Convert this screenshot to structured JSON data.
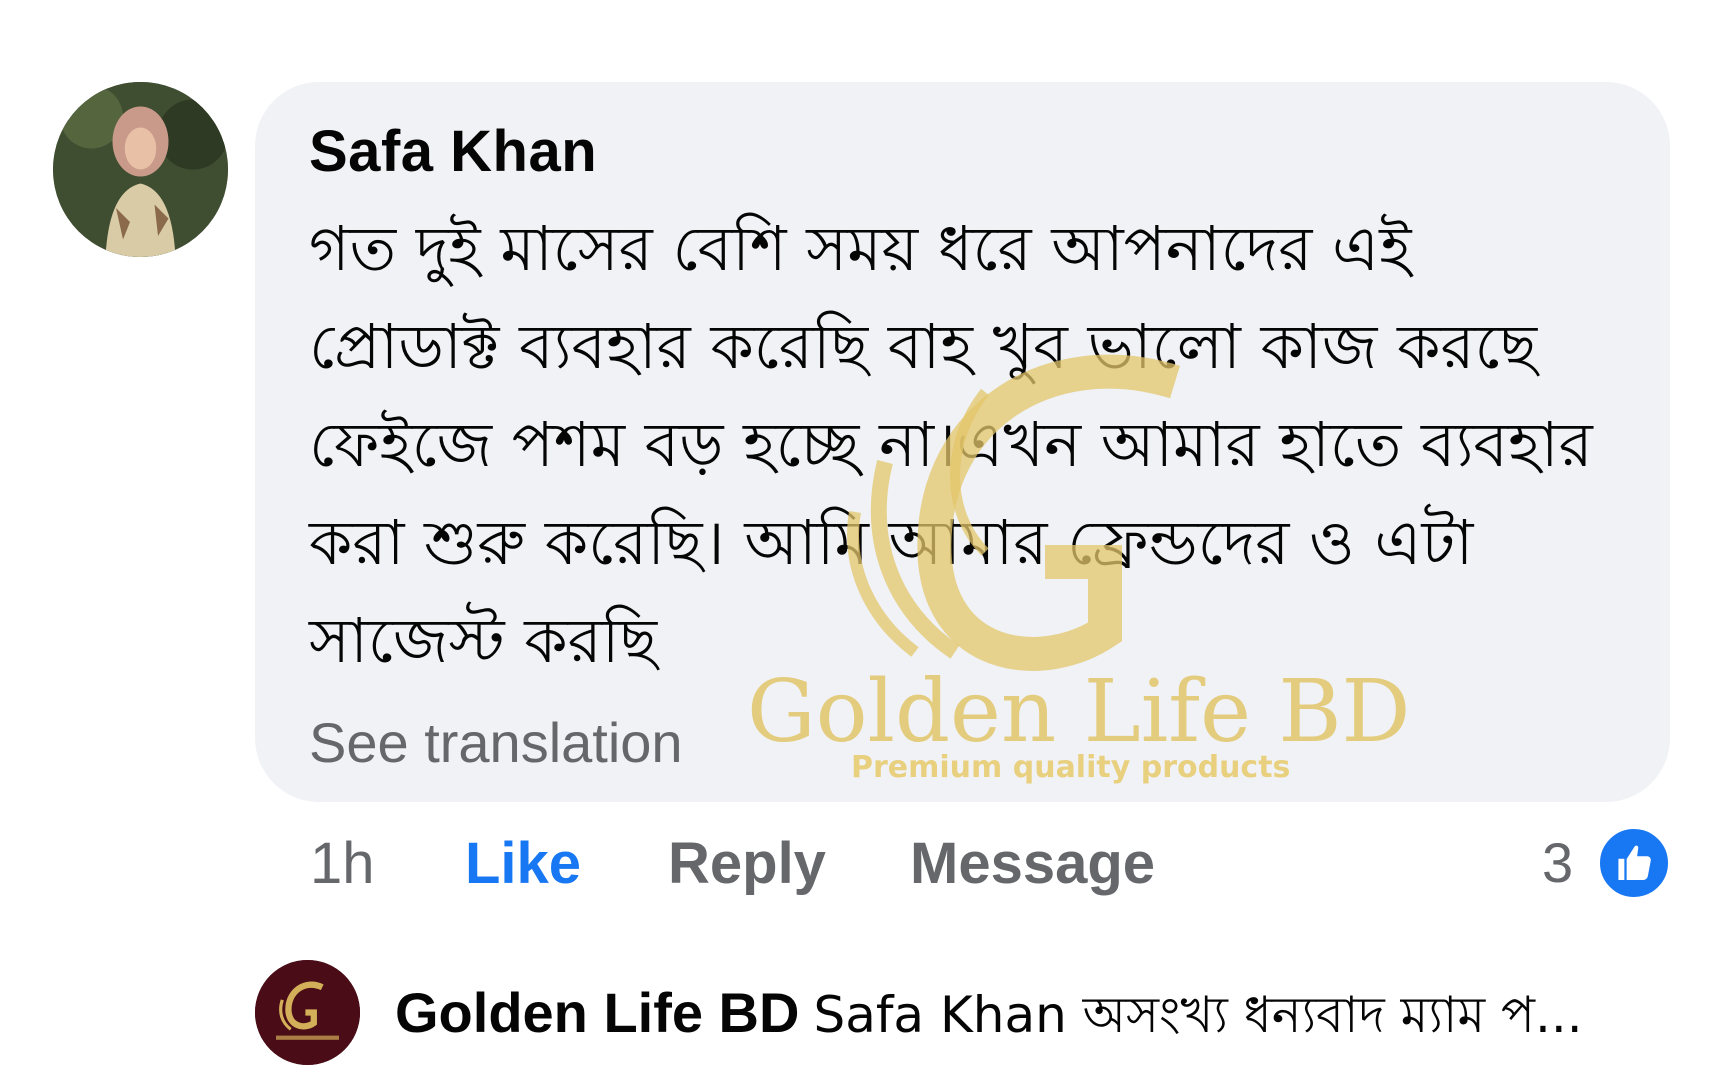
{
  "comment": {
    "author": "Safa Khan",
    "text": "গত দুই মাসের বেশি সময় ধরে আপনাদের এই প্রোডাক্ট ব্যবহার করেছি বাহ খুব ভালো কাজ করছে  ফেইজে পশম বড় হচ্ছে না।এখন আমার হাতে ব্যবহার করা শুরু করেছি। আমি আমার ফ্রেন্ডদের ও এটা সাজেস্ট করছি",
    "see_translation": "See translation",
    "time": "1h",
    "like_label": "Like",
    "reply_label": "Reply",
    "message_label": "Message",
    "reaction_count": "3",
    "reaction_icon": "like-thumb-icon"
  },
  "watermark": {
    "brand": "Golden Life BD",
    "tagline": "Premium quality products",
    "color": "#e3c66a"
  },
  "reply_preview": {
    "author": "Golden Life BD",
    "text": "Safa Khan অসংখ্য ধন্যবাদ ম্যাম প..."
  },
  "colors": {
    "bubble": "#f0f2f5",
    "like_active": "#1877f2",
    "secondary_text": "#65676b"
  }
}
